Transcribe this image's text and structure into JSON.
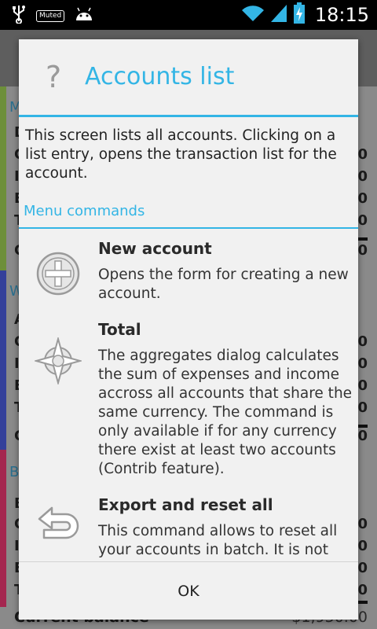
{
  "status_bar": {
    "icons": [
      "usb-icon",
      "muted-badge",
      "android-icon",
      "wifi-icon",
      "signal-icon",
      "battery-charging-icon"
    ],
    "muted_label": "Muted",
    "time": "18:15"
  },
  "background": {
    "colors": {
      "stripe_green": "#8bc34a",
      "stripe_blue": "#3f51b5",
      "stripe_pink": "#e91e63"
    },
    "sections": [
      {
        "title_initial": "M",
        "row_initials": [
          "D",
          "C",
          "I",
          "E",
          "T",
          "C"
        ],
        "row_values": [
          "0",
          "0",
          "0",
          "0",
          "0"
        ]
      },
      {
        "title_initial": "W",
        "row_initials": [
          "A",
          "C",
          "I",
          "E",
          "T",
          "C"
        ],
        "row_values": [
          "0",
          "0",
          "0",
          "0",
          "0"
        ]
      },
      {
        "title_initial": "B",
        "row_initials": [
          "B",
          "C",
          "I",
          "E",
          "T"
        ],
        "row_values": [
          "0",
          "0",
          "0",
          "0",
          "0"
        ]
      }
    ],
    "bottom_label": "Current balance",
    "bottom_value": "$1,950.00"
  },
  "dialog": {
    "icon": "help-question-icon",
    "title": "Accounts list",
    "intro": "This screen lists all accounts. Clicking on a list entry, opens the transaction list for the account.",
    "section_title": "Menu commands",
    "commands": [
      {
        "icon": "add-circle-icon",
        "title": "New account",
        "description": "Opens the form for creating a new account."
      },
      {
        "icon": "aggregate-compass-icon",
        "title": "Total",
        "description": "The aggregates dialog calculates the sum of expenses and income accross all accounts that share the same currency. The command is only available if for any currency there exist at least two accounts (Contrib feature)."
      },
      {
        "icon": "undo-arrow-icon",
        "title": "Export and reset all",
        "description": "This command allows to reset all your accounts in batch. It is not"
      }
    ],
    "ok_label": "OK",
    "accent_color": "#33b5e5"
  }
}
